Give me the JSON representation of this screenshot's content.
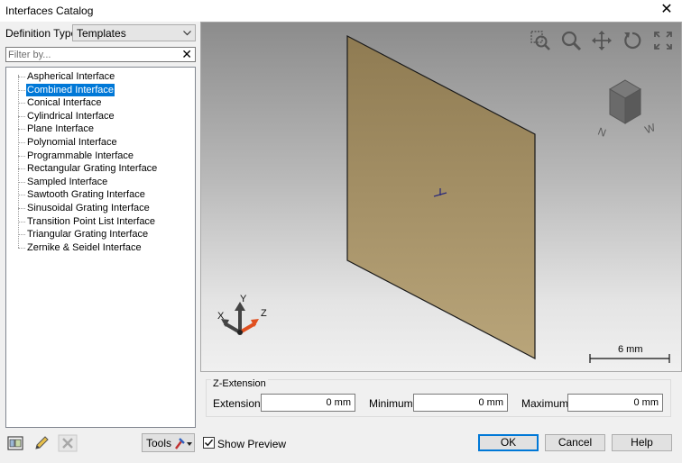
{
  "window": {
    "title": "Interfaces Catalog",
    "close_glyph": "✕"
  },
  "definition_type": {
    "label": "Definition Type",
    "selected": "Templates"
  },
  "filter": {
    "placeholder": "Filter by...",
    "value": "",
    "clear_glyph": "✕"
  },
  "tree": {
    "selected_index": 1,
    "items": [
      "Aspherical Interface",
      "Combined Interface",
      "Conical Interface",
      "Cylindrical Interface",
      "Plane Interface",
      "Polynomial Interface",
      "Programmable Interface",
      "Rectangular Grating Interface",
      "Sampled Interface",
      "Sawtooth Grating Interface",
      "Sinusoidal Grating Interface",
      "Transition Point List Interface",
      "Triangular Grating Interface",
      "Zernike & Seidel Interface"
    ]
  },
  "viewport": {
    "toolbar_icons": [
      "zoom-window-icon",
      "zoom-icon",
      "pan-icon",
      "rotate-icon",
      "fullscreen-icon"
    ],
    "surface_color": "#b09c70",
    "axes": {
      "x": "X",
      "y": "Y",
      "z": "Z"
    },
    "orientation_cube": {
      "labels": [
        "N",
        "W"
      ]
    },
    "scale_bar": "6 mm"
  },
  "z_extension": {
    "title": "Z-Extension",
    "extension": {
      "label": "Extension",
      "value": "0 mm"
    },
    "minimum": {
      "label": "Minimum",
      "value": "0 mm"
    },
    "maximum": {
      "label": "Maximum",
      "value": "0 mm"
    }
  },
  "footer": {
    "icons": [
      "catalog-icon",
      "edit-pencil-icon",
      "delete-icon"
    ],
    "tools_label": "Tools",
    "show_preview": {
      "label": "Show Preview",
      "checked": true
    },
    "ok": "OK",
    "cancel": "Cancel",
    "help": "Help"
  }
}
